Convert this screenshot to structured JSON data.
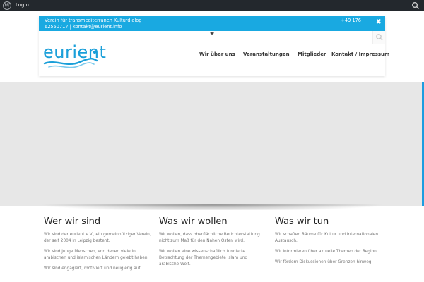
{
  "adminbar": {
    "login_label": "Login",
    "icons": [
      "wordpress-icon",
      "search-icon"
    ]
  },
  "topbar": {
    "line1": "Verein für transmediterranen Kulturdialog",
    "line2": "62550717   |   kontakt@eurient.info",
    "phone": "+49 176",
    "close_icon": "✖"
  },
  "header": {
    "toggle_icon": "❤",
    "logo_text": "eurient",
    "nav": [
      "Wir über uns",
      "Veranstaltungen",
      "Mitglieder",
      "Kontakt / Impressum"
    ]
  },
  "colors": {
    "accent": "#19a9e1",
    "adminbar": "#23282d",
    "hero": "#e7e7e7"
  },
  "columns": [
    {
      "title": "Wer wir sind",
      "paragraphs": [
        "Wir sind der eurient e.V., ein gemeinnütziger Verein, der seit 2004 in Leipzig besteht.",
        "Wir sind junge Menschen, von denen viele in arabischen und islamischen Ländern gelebt haben.",
        "Wir sind engagiert, motiviert und neugierig auf"
      ]
    },
    {
      "title": "Was wir wollen",
      "paragraphs": [
        "Wir wollen, dass oberflächliche Berichterstattung nicht zum Maß für den Nahen Osten wird.",
        "Wir wollen eine wissenschaftlich fundierte Betrachtung der Themengebiete Islam und arabische Welt."
      ]
    },
    {
      "title": "Was wir tun",
      "paragraphs": [
        "Wir schaffen Räume für Kultur und internationalen Austausch.",
        "Wir informieren über aktuelle Themen der Region.",
        "Wir fördern Diskussionen über Grenzen hinweg."
      ]
    }
  ]
}
